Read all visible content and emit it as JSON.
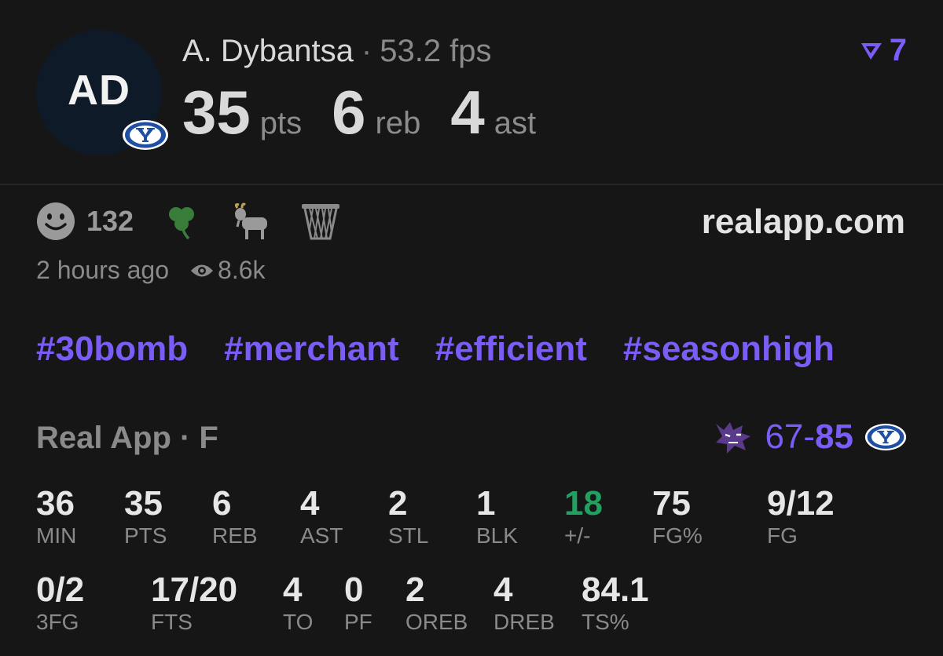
{
  "header": {
    "avatar_initials": "AD",
    "player_name": "A. Dybantsa",
    "separator": "·",
    "fps": "53.2 fps",
    "rank": "7",
    "statline": [
      {
        "value": "35",
        "unit": "pts"
      },
      {
        "value": "6",
        "unit": "reb"
      },
      {
        "value": "4",
        "unit": "ast"
      }
    ]
  },
  "reactions": {
    "smiley_count": "132"
  },
  "site": "realapp.com",
  "meta": {
    "time_ago": "2 hours ago",
    "views": "8.6k"
  },
  "tags": [
    "#30bomb",
    "#merchant",
    "#efficient",
    "#seasonhigh"
  ],
  "game": {
    "label": "Real App · F",
    "score_away": "67",
    "score_dash": "-",
    "score_home": "85"
  },
  "box_score": {
    "row1": [
      {
        "value": "36",
        "label": "MIN"
      },
      {
        "value": "35",
        "label": "PTS"
      },
      {
        "value": "6",
        "label": "REB"
      },
      {
        "value": "4",
        "label": "AST"
      },
      {
        "value": "2",
        "label": "STL"
      },
      {
        "value": "1",
        "label": "BLK"
      },
      {
        "value": "18",
        "label": "+/-"
      },
      {
        "value": "75",
        "label": "FG%"
      },
      {
        "value": "9/12",
        "label": "FG"
      }
    ],
    "row2": [
      {
        "value": "0/2",
        "label": "3FG"
      },
      {
        "value": "17/20",
        "label": "FTS"
      },
      {
        "value": "4",
        "label": "TO"
      },
      {
        "value": "0",
        "label": "PF"
      },
      {
        "value": "2",
        "label": "OREB"
      },
      {
        "value": "4",
        "label": "DREB"
      },
      {
        "value": "84.1",
        "label": "TS%"
      }
    ]
  },
  "colors": {
    "background": "#161616",
    "accent": "#7b5cf6",
    "positive": "#22a060",
    "byu_blue": "#1e4fa3"
  }
}
